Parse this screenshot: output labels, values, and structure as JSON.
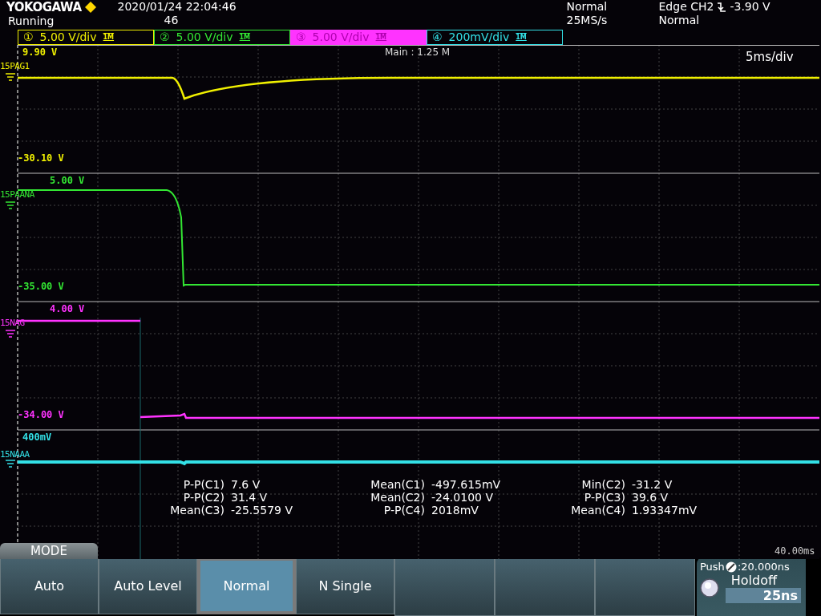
{
  "header": {
    "brand": "YOKOGAWA",
    "state": "Running",
    "datetime": "2020/01/24 22:04:46",
    "count": "46",
    "acq_mode": "Normal",
    "sample_rate": "25MS/s",
    "trigger": "Edge CH2",
    "trigger_level": "-3.90 V",
    "trigger_mode": "Normal"
  },
  "channels": [
    {
      "number": "①",
      "scale": "5.00 V/div",
      "coupling": "1M",
      "color": "#f0f000",
      "selected": false,
      "name": "15PAG1",
      "top": "9.90 V",
      "bottom": "-30.10 V"
    },
    {
      "number": "②",
      "scale": "5.00 V/div",
      "coupling": "1M",
      "color": "#33e633",
      "selected": false,
      "name": "15PAANA",
      "top": "5.00 V",
      "bottom": "-35.00 V"
    },
    {
      "number": "③",
      "scale": "5.00 V/div",
      "coupling": "1M",
      "color": "#ff33ff",
      "selected": true,
      "name": "15NAG",
      "top": "4.00 V",
      "bottom": "-34.00 V"
    },
    {
      "number": "④",
      "scale": "200mV/div",
      "coupling": "1M",
      "color": "#33e0e6",
      "selected": false,
      "name": "15NAAA",
      "top": "400mV"
    }
  ],
  "zoom_label": "Main : 1.25 M",
  "timebase": "5ms/div",
  "time_span": "40.00ms",
  "measurements": [
    [
      {
        "label": "P-P(C1)",
        "value": "7.6 V"
      },
      {
        "label": "P-P(C2)",
        "value": "31.4 V"
      },
      {
        "label": "Mean(C3)",
        "value": "-25.5579 V"
      }
    ],
    [
      {
        "label": "Mean(C1)",
        "value": "-497.615mV"
      },
      {
        "label": "Mean(C2)",
        "value": "-24.0100 V"
      },
      {
        "label": "P-P(C4)",
        "value": "2018mV"
      }
    ],
    [
      {
        "label": "Min(C2)",
        "value": "-31.2 V"
      },
      {
        "label": "P-P(C3)",
        "value": "39.6 V"
      },
      {
        "label": "Mean(C4)",
        "value": "1.93347mV"
      }
    ]
  ],
  "menu": {
    "title": "MODE",
    "keys": [
      {
        "kind": "label",
        "label": "Auto",
        "selected": false
      },
      {
        "kind": "label",
        "label": "Auto Level",
        "selected": false
      },
      {
        "kind": "label",
        "label": "Normal",
        "selected": true
      },
      {
        "kind": "label",
        "label": "N Single",
        "selected": false
      },
      {
        "kind": "blank",
        "selected": false
      },
      {
        "kind": "blank",
        "selected": false
      },
      {
        "kind": "blank",
        "selected": false
      }
    ]
  },
  "holdoff": {
    "push": "Push",
    "step": ":20.000ns",
    "title": "Holdoff",
    "value": "25ns"
  }
}
